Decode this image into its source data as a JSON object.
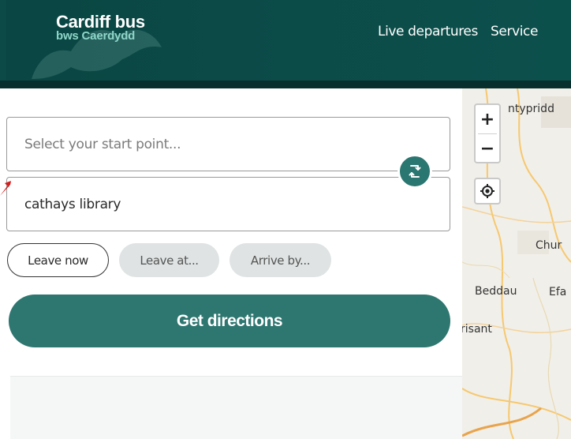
{
  "header": {
    "logo_title": "Cardiff bus",
    "logo_subtitle": "bws Caerdydd",
    "nav": [
      {
        "label": "Live departures"
      },
      {
        "label": "Service"
      }
    ]
  },
  "planner": {
    "start_placeholder": "Select your start point...",
    "start_value": "",
    "end_value": "cathays library",
    "time_options": [
      {
        "label": "Leave now",
        "selected": true
      },
      {
        "label": "Leave at...",
        "selected": false
      },
      {
        "label": "Arrive by...",
        "selected": false
      }
    ],
    "submit_label": "Get directions"
  },
  "map": {
    "zoom_in": "+",
    "zoom_out": "−",
    "place_labels": [
      "ntypridd",
      "Chur",
      "Beddau",
      "Efa",
      "risant"
    ]
  },
  "colors": {
    "header_bg": "#0b4a47",
    "brand_teal": "#2e7670",
    "logo_subtitle": "#8fd6c9",
    "pill_inactive": "#dfe3e3"
  },
  "icons": {
    "swap": "swap-arrows-icon",
    "locate": "locate-target-icon"
  }
}
